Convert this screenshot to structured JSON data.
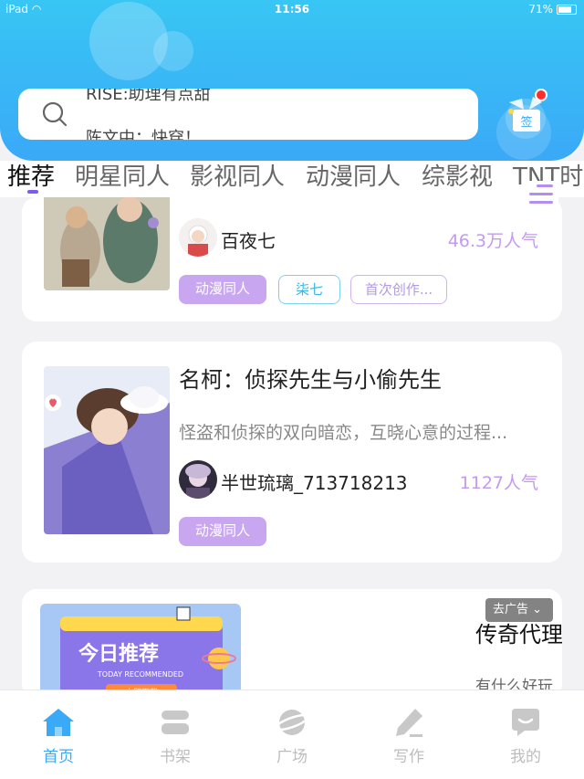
{
  "status_bar": {
    "device": "iPad",
    "time": "11:56",
    "battery": "71%"
  },
  "search": {
    "rolling_lines": [
      "RISE:助理有点甜",
      "陈文中：快穿！"
    ]
  },
  "sign_in": {
    "label": "签"
  },
  "category_tabs": [
    {
      "label": "推荐",
      "active": true
    },
    {
      "label": "明星同人"
    },
    {
      "label": "影视同人"
    },
    {
      "label": "动漫同人"
    },
    {
      "label": "综影视"
    },
    {
      "label": "TNT时"
    }
  ],
  "cards": [
    {
      "author": "百夜七",
      "popularity": "46.3万人气",
      "tags": [
        "动漫同人",
        "柒七",
        "首次创作..."
      ]
    },
    {
      "title": "名柯：侦探先生与小偷先生",
      "desc": "怪盗和侦探的双向暗恋，互晓心意的过程...",
      "author": "半世琉璃_713718213",
      "popularity": "1127人气",
      "tags": [
        "动漫同人"
      ]
    }
  ],
  "ad": {
    "badge": "去广告",
    "title": "传奇代理",
    "subtitle": "有什么好玩",
    "banner_text": "今日推荐",
    "banner_sub": "TODAY RECOMMENDED",
    "banner_button": "立即下载"
  },
  "bottom_nav": [
    {
      "label": "首页",
      "icon": "home-icon",
      "active": true
    },
    {
      "label": "书架",
      "icon": "bookshelf-icon"
    },
    {
      "label": "广场",
      "icon": "square-planet-icon"
    },
    {
      "label": "写作",
      "icon": "pen-icon"
    },
    {
      "label": "我的",
      "icon": "profile-chat-icon"
    }
  ],
  "colors": {
    "header": "#3aa9f7",
    "accent": "#c8a6f0",
    "nav_active": "#3aa9f7"
  }
}
